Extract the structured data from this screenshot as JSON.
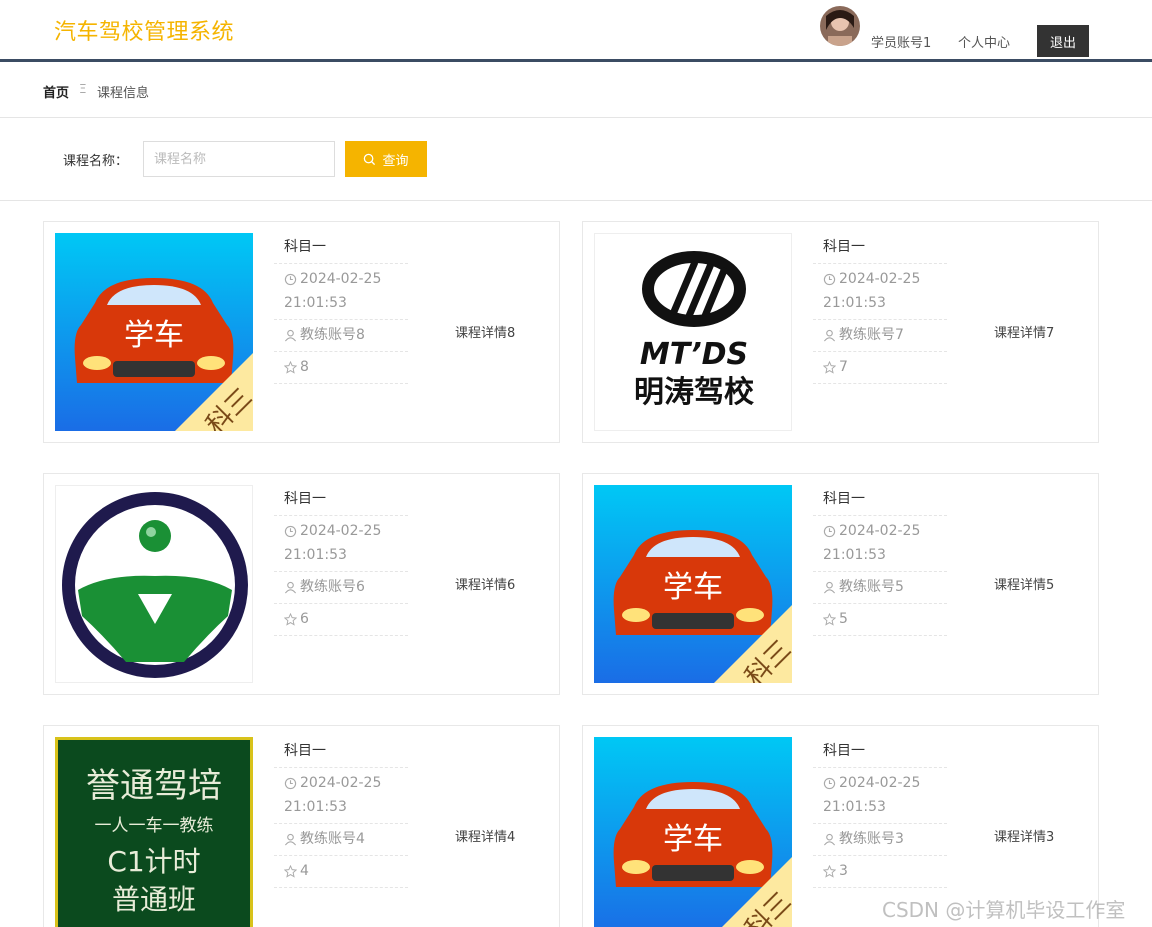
{
  "header": {
    "site_title": "汽车驾校管理系统",
    "account": "学员账号1",
    "personal_center": "个人中心",
    "logout": "退出"
  },
  "breadcrumb": {
    "home": "首页",
    "separator": "Ξ",
    "current": "课程信息"
  },
  "search": {
    "label": "课程名称：",
    "placeholder": "课程名称",
    "value": "",
    "button": "查询"
  },
  "colors": {
    "accent": "#f5b400",
    "header_border": "#3b4c63",
    "dark_button": "#333333"
  },
  "courses": [
    {
      "title": "科目一",
      "date": "2024-02-25",
      "time": "21:01:53",
      "coach": "教练账号8",
      "favorites": "8",
      "detail": "课程详情8",
      "image": "car-logo",
      "image_text": "学车",
      "image_badge": "科三"
    },
    {
      "title": "科目一",
      "date": "2024-02-25",
      "time": "21:01:53",
      "coach": "教练账号7",
      "favorites": "7",
      "detail": "课程详情7",
      "image": "mtds-logo",
      "image_text": "MT’DS",
      "image_subtext": "明涛驾校"
    },
    {
      "title": "科目一",
      "date": "2024-02-25",
      "time": "21:01:53",
      "coach": "教练账号6",
      "favorites": "6",
      "detail": "课程详情6",
      "image": "steering-wheel-logo"
    },
    {
      "title": "科目一",
      "date": "2024-02-25",
      "time": "21:01:53",
      "coach": "教练账号5",
      "favorites": "5",
      "detail": "课程详情5",
      "image": "car-logo",
      "image_text": "学车",
      "image_badge": "科三"
    },
    {
      "title": "科目一",
      "date": "2024-02-25",
      "time": "21:01:53",
      "coach": "教练账号4",
      "favorites": "4",
      "detail": "课程详情4",
      "image": "chalkboard",
      "image_lines": [
        "誉通驾培",
        "一人一车一教练",
        "C1计时",
        "普通班"
      ]
    },
    {
      "title": "科目一",
      "date": "2024-02-25",
      "time": "21:01:53",
      "coach": "教练账号3",
      "favorites": "3",
      "detail": "课程详情3",
      "image": "car-logo",
      "image_text": "学车",
      "image_badge": "科三"
    }
  ],
  "watermark": "CSDN @计算机毕设工作室"
}
